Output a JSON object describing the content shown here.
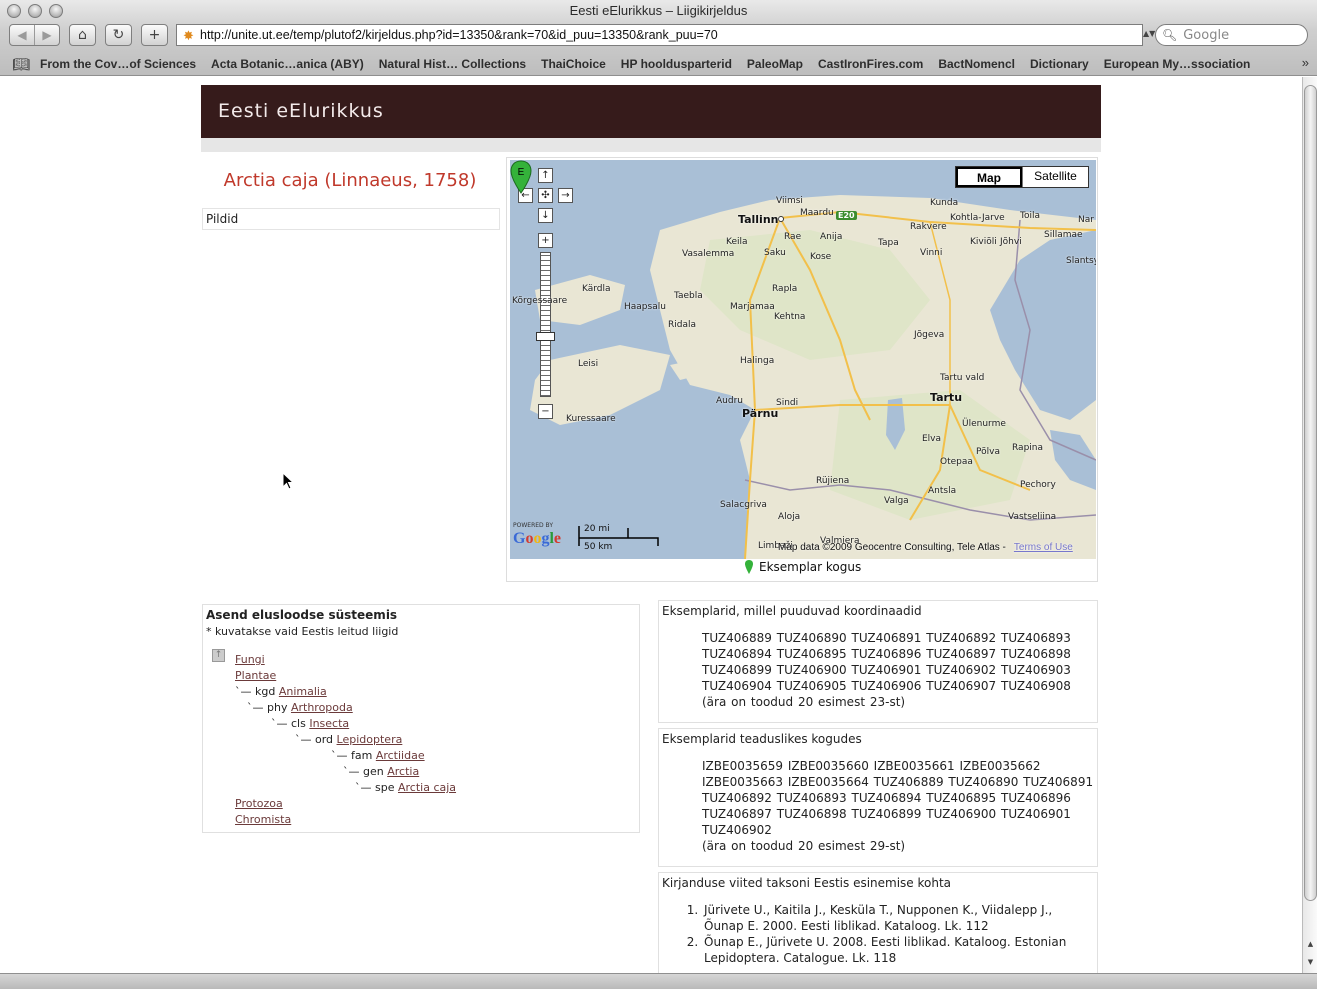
{
  "window": {
    "title": "Eesti eElurikkus – Liigikirjeldus"
  },
  "toolbar": {
    "back_icon": "back-arrow",
    "forward_icon": "forward-arrow",
    "home_icon": "home",
    "reload_icon": "reload",
    "add_icon": "plus",
    "url": "http://unite.ut.ee/temp/plutof2/kirjeldus.php?id=13350&rank=70&id_puu=13350&rank_puu=70",
    "search_placeholder": "Google"
  },
  "bookmarks": [
    "From the Cov…of Sciences",
    "Acta Botanic…anica (ABY)",
    "Natural Hist… Collections",
    "ThaiChoice",
    "HP hooldusparterid",
    "PaleoMap",
    "CastIronFires.com",
    "BactNomencl",
    "Dictionary",
    "European My…ssociation"
  ],
  "page": {
    "site_title": "Eesti eElurikkus",
    "species_title": "Arctia caja (Linnaeus, 1758)",
    "pildid_label": "Pildid"
  },
  "map": {
    "type_map": "Map",
    "type_satellite": "Satellite",
    "road_badge": "E20",
    "cities": [
      "Tallinn",
      "Maardu",
      "Viimsi",
      "Kunda",
      "Kohtla-Jarve",
      "Toila",
      "Sillamae",
      "Nar",
      "Keila",
      "Rae",
      "Anija",
      "Rakvere",
      "Kiviõli",
      "Jõhvi",
      "Vasalemma",
      "Saku",
      "Kose",
      "Tapa",
      "Vinni",
      "Slantsy",
      "Kärdla",
      "Taebla",
      "Rapla",
      "Haapsalu",
      "Marjamaa",
      "Kehtna",
      "Ridala",
      "Jõgeva",
      "Tartu vald",
      "Leisi",
      "Halinga",
      "Audru",
      "Sindi",
      "Pärnu",
      "Tartu",
      "Ülenurme",
      "Kuressaare",
      "Elva",
      "Rapina",
      "Otepaa",
      "Põlva",
      "Rüjiena",
      "Antsla",
      "Pechory",
      "Valga",
      "Salacgriva",
      "Aloja",
      "Vastseliina",
      "Valmiera",
      "Limbaži",
      "Kõrgessaare"
    ],
    "scale_mi": "20 mi",
    "scale_km": "50 km",
    "powered_by": "POWERED BY",
    "google": "Google",
    "copyright": "Map data ©2009 Geocentre Consulting, Tele Atlas -",
    "terms": "Terms of Use",
    "legend": "Eksemplar kogus"
  },
  "taxonomy": {
    "title": "Asend elusloodse süsteemis",
    "note": "* kuvatakse vaid Eestis leitud liigid",
    "rows": [
      {
        "prefix": "",
        "link": "Fungi"
      },
      {
        "prefix": "",
        "link": "Plantae"
      },
      {
        "prefix": "`— kgd ",
        "link": "Animalia"
      },
      {
        "prefix": "`— phy ",
        "link": "Arthropoda"
      },
      {
        "prefix": "`— cls ",
        "link": "Insecta"
      },
      {
        "prefix": "`— ord ",
        "link": "Lepidoptera"
      },
      {
        "prefix": "`— fam ",
        "link": "Arctiidae"
      },
      {
        "prefix": "`— gen ",
        "link": "Arctia"
      },
      {
        "prefix": "`— spe ",
        "link": "Arctia caja"
      },
      {
        "prefix": "",
        "link": "Protozoa"
      },
      {
        "prefix": "",
        "link": "Chromista"
      }
    ]
  },
  "no_coords": {
    "title": "Eksemplarid, millel puuduvad koordinaadid",
    "lines": [
      "TUZ406889 TUZ406890 TUZ406891 TUZ406892 TUZ406893",
      "TUZ406894 TUZ406895 TUZ406896 TUZ406897 TUZ406898",
      "TUZ406899 TUZ406900 TUZ406901 TUZ406902 TUZ406903",
      "TUZ406904 TUZ406905 TUZ406906 TUZ406907 TUZ406908",
      "(ära on toodud 20 esimest 23-st)"
    ]
  },
  "collections": {
    "title": "Eksemplarid teaduslikes kogudes",
    "lines": [
      "IZBE0035659 IZBE0035660 IZBE0035661 IZBE0035662",
      "IZBE0035663 IZBE0035664 TUZ406889 TUZ406890 TUZ406891",
      "TUZ406892 TUZ406893 TUZ406894 TUZ406895 TUZ406896",
      "TUZ406897 TUZ406898 TUZ406899 TUZ406900 TUZ406901",
      "TUZ406902",
      "(ära on toodud 20 esimest 29-st)"
    ]
  },
  "literature": {
    "title": "Kirjanduse viited taksoni Eestis esinemise kohta",
    "items": [
      "Jürivete U., Kaitila J., Kesküla T., Nupponen K., Viidalepp J., Õunap E. 2000. Eesti liblikad. Kataloog. Lk. 112",
      "Õunap E., Jürivete U. 2008. Eesti liblikad. Kataloog. Estonian Lepidoptera. Catalogue. Lk. 118"
    ]
  }
}
